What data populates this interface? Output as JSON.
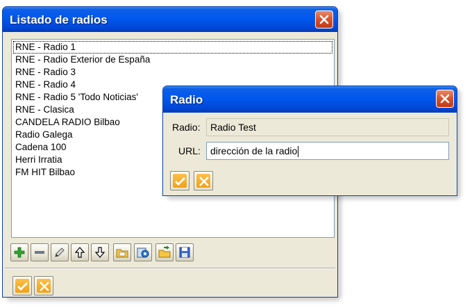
{
  "main_window": {
    "title": "Listado de radios",
    "radios": [
      "RNE - Radio 1",
      "RNE - Radio Exterior de España",
      "RNE - Radio 3",
      "RNE - Radio 4",
      "RNE - Radio 5 'Todo Noticias'",
      "RNE - Clasica",
      "CANDELA RADIO Bilbao",
      "Radio Galega",
      "Cadena 100",
      "Herri Irratia",
      "FM HIT Bilbao"
    ],
    "selected_index": 0,
    "toolbar_icons": [
      "add-icon",
      "remove-icon",
      "edit-icon",
      "move-up-icon",
      "move-down-icon",
      "open-folder-icon",
      "import-icon",
      "export-icon",
      "save-icon"
    ]
  },
  "radio_dialog": {
    "title": "Radio",
    "name_label": "Radio:",
    "name_value": "Radio Test",
    "url_label": "URL:",
    "url_value": "dirección de la radio"
  },
  "colors": {
    "titlebar": "#0058ee",
    "window_bg": "#ece9d8",
    "close": "#d9512e",
    "ok": "#f2a114"
  }
}
